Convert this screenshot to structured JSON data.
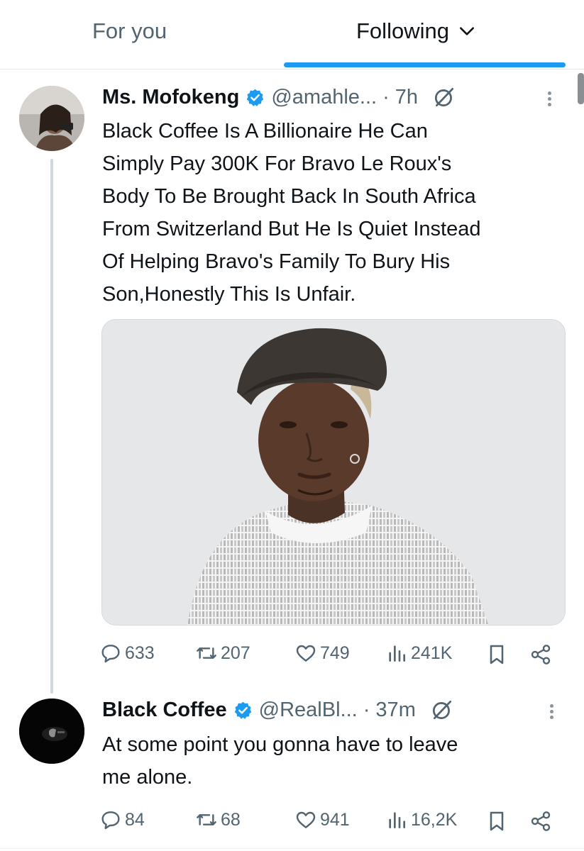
{
  "tabs": {
    "for_you": "For you",
    "following": "Following"
  },
  "colors": {
    "accent": "#1d9bf0",
    "text_primary": "#0f1419",
    "text_secondary": "#536471"
  },
  "tweets": [
    {
      "name": "Ms. Mofokeng",
      "handle": "@amahle...",
      "time": "· 7h",
      "text": "Black Coffee Is A Billionaire He Can\nSimply Pay 300K For Bravo Le Roux's\nBody To Be Brought Back In South Africa\nFrom Switzerland But He Is Quiet Instead\nOf Helping Bravo's Family To Bury His\nSon,Honestly This Is Unfair.",
      "has_media": true,
      "replies": "633",
      "reposts": "207",
      "likes": "749",
      "views": "241K"
    },
    {
      "name": "Black Coffee",
      "handle": "@RealBl...",
      "time": "· 37m",
      "text": "At some point you gonna have to leave\nme alone.",
      "has_media": false,
      "replies": "84",
      "reposts": "68",
      "likes": "941",
      "views": "16,2K"
    }
  ],
  "icons": {
    "verified": "verified-badge-icon",
    "grok": "grok-icon",
    "more": "more-options-icon",
    "reply": "reply-icon",
    "repost": "repost-icon",
    "like": "like-icon",
    "views": "views-icon",
    "bookmark": "bookmark-icon",
    "share": "share-icon"
  }
}
